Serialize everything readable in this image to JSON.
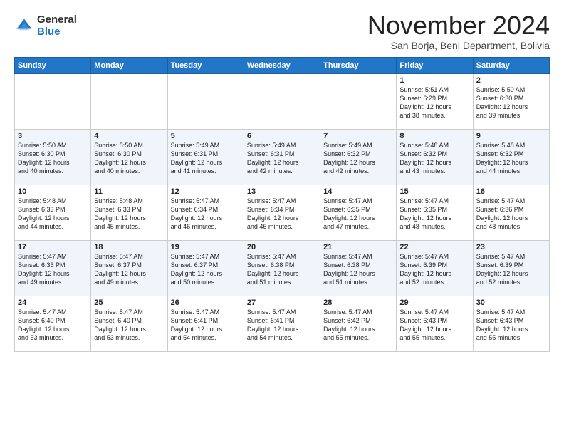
{
  "header": {
    "logo_general": "General",
    "logo_blue": "Blue",
    "month_title": "November 2024",
    "subtitle": "San Borja, Beni Department, Bolivia"
  },
  "days_of_week": [
    "Sunday",
    "Monday",
    "Tuesday",
    "Wednesday",
    "Thursday",
    "Friday",
    "Saturday"
  ],
  "weeks": [
    [
      {
        "day": "",
        "info": ""
      },
      {
        "day": "",
        "info": ""
      },
      {
        "day": "",
        "info": ""
      },
      {
        "day": "",
        "info": ""
      },
      {
        "day": "",
        "info": ""
      },
      {
        "day": "1",
        "info": "Sunrise: 5:51 AM\nSunset: 6:29 PM\nDaylight: 12 hours\nand 38 minutes."
      },
      {
        "day": "2",
        "info": "Sunrise: 5:50 AM\nSunset: 6:30 PM\nDaylight: 12 hours\nand 39 minutes."
      }
    ],
    [
      {
        "day": "3",
        "info": "Sunrise: 5:50 AM\nSunset: 6:30 PM\nDaylight: 12 hours\nand 40 minutes."
      },
      {
        "day": "4",
        "info": "Sunrise: 5:50 AM\nSunset: 6:30 PM\nDaylight: 12 hours\nand 40 minutes."
      },
      {
        "day": "5",
        "info": "Sunrise: 5:49 AM\nSunset: 6:31 PM\nDaylight: 12 hours\nand 41 minutes."
      },
      {
        "day": "6",
        "info": "Sunrise: 5:49 AM\nSunset: 6:31 PM\nDaylight: 12 hours\nand 42 minutes."
      },
      {
        "day": "7",
        "info": "Sunrise: 5:49 AM\nSunset: 6:32 PM\nDaylight: 12 hours\nand 42 minutes."
      },
      {
        "day": "8",
        "info": "Sunrise: 5:48 AM\nSunset: 6:32 PM\nDaylight: 12 hours\nand 43 minutes."
      },
      {
        "day": "9",
        "info": "Sunrise: 5:48 AM\nSunset: 6:32 PM\nDaylight: 12 hours\nand 44 minutes."
      }
    ],
    [
      {
        "day": "10",
        "info": "Sunrise: 5:48 AM\nSunset: 6:33 PM\nDaylight: 12 hours\nand 44 minutes."
      },
      {
        "day": "11",
        "info": "Sunrise: 5:48 AM\nSunset: 6:33 PM\nDaylight: 12 hours\nand 45 minutes."
      },
      {
        "day": "12",
        "info": "Sunrise: 5:47 AM\nSunset: 6:34 PM\nDaylight: 12 hours\nand 46 minutes."
      },
      {
        "day": "13",
        "info": "Sunrise: 5:47 AM\nSunset: 6:34 PM\nDaylight: 12 hours\nand 46 minutes."
      },
      {
        "day": "14",
        "info": "Sunrise: 5:47 AM\nSunset: 6:35 PM\nDaylight: 12 hours\nand 47 minutes."
      },
      {
        "day": "15",
        "info": "Sunrise: 5:47 AM\nSunset: 6:35 PM\nDaylight: 12 hours\nand 48 minutes."
      },
      {
        "day": "16",
        "info": "Sunrise: 5:47 AM\nSunset: 6:36 PM\nDaylight: 12 hours\nand 48 minutes."
      }
    ],
    [
      {
        "day": "17",
        "info": "Sunrise: 5:47 AM\nSunset: 6:36 PM\nDaylight: 12 hours\nand 49 minutes."
      },
      {
        "day": "18",
        "info": "Sunrise: 5:47 AM\nSunset: 6:37 PM\nDaylight: 12 hours\nand 49 minutes."
      },
      {
        "day": "19",
        "info": "Sunrise: 5:47 AM\nSunset: 6:37 PM\nDaylight: 12 hours\nand 50 minutes."
      },
      {
        "day": "20",
        "info": "Sunrise: 5:47 AM\nSunset: 6:38 PM\nDaylight: 12 hours\nand 51 minutes."
      },
      {
        "day": "21",
        "info": "Sunrise: 5:47 AM\nSunset: 6:38 PM\nDaylight: 12 hours\nand 51 minutes."
      },
      {
        "day": "22",
        "info": "Sunrise: 5:47 AM\nSunset: 6:39 PM\nDaylight: 12 hours\nand 52 minutes."
      },
      {
        "day": "23",
        "info": "Sunrise: 5:47 AM\nSunset: 6:39 PM\nDaylight: 12 hours\nand 52 minutes."
      }
    ],
    [
      {
        "day": "24",
        "info": "Sunrise: 5:47 AM\nSunset: 6:40 PM\nDaylight: 12 hours\nand 53 minutes."
      },
      {
        "day": "25",
        "info": "Sunrise: 5:47 AM\nSunset: 6:40 PM\nDaylight: 12 hours\nand 53 minutes."
      },
      {
        "day": "26",
        "info": "Sunrise: 5:47 AM\nSunset: 6:41 PM\nDaylight: 12 hours\nand 54 minutes."
      },
      {
        "day": "27",
        "info": "Sunrise: 5:47 AM\nSunset: 6:41 PM\nDaylight: 12 hours\nand 54 minutes."
      },
      {
        "day": "28",
        "info": "Sunrise: 5:47 AM\nSunset: 6:42 PM\nDaylight: 12 hours\nand 55 minutes."
      },
      {
        "day": "29",
        "info": "Sunrise: 5:47 AM\nSunset: 6:43 PM\nDaylight: 12 hours\nand 55 minutes."
      },
      {
        "day": "30",
        "info": "Sunrise: 5:47 AM\nSunset: 6:43 PM\nDaylight: 12 hours\nand 55 minutes."
      }
    ]
  ]
}
